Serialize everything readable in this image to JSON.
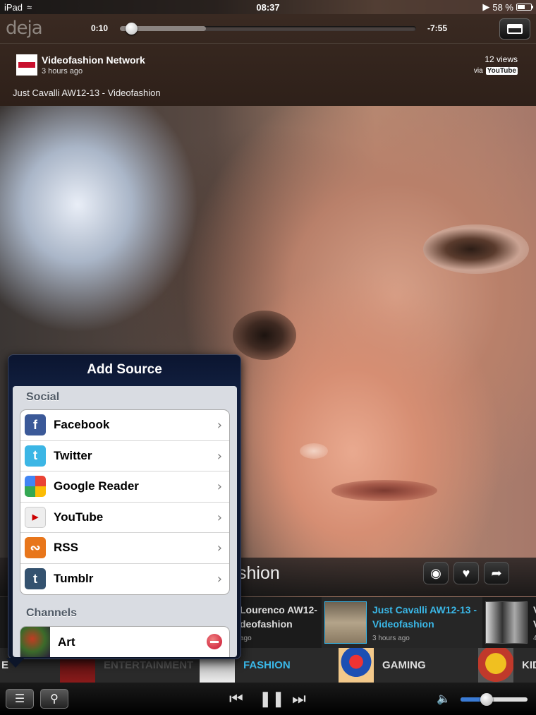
{
  "status": {
    "device": "iPad",
    "time": "08:37",
    "battery": "58 %",
    "battery_level": 0.58
  },
  "player": {
    "logo": "deja",
    "elapsed": "0:10",
    "remaining": "-7:55",
    "progress": 0.02,
    "buffered": 0.29
  },
  "info": {
    "channel_name": "Videofashion Network",
    "posted": "3 hours ago",
    "views": "12 views",
    "via": "via",
    "via_source": "YouTube",
    "title": "Just Cavalli AW12-13 - Videofashion"
  },
  "category_title": "shion",
  "strip": [
    {
      "title_line1": "Lourenco AW12-",
      "title_line2": "deofashion",
      "time": "ago",
      "active": false
    },
    {
      "title_line1": "Just Cavalli AW12-13 -",
      "title_line2": "Videofashion",
      "time": "3 hours ago",
      "active": true
    },
    {
      "title_line1": "V",
      "title_line2": "V",
      "time": "4",
      "active": false
    }
  ],
  "channels": [
    {
      "label": "E"
    },
    {
      "label": "ENTERTAINMENT"
    },
    {
      "label": "FASHION",
      "active": true
    },
    {
      "label": "GAMING"
    },
    {
      "label": "KID"
    }
  ],
  "controls": {
    "volume": 0.37
  },
  "popover": {
    "title": "Add Source",
    "sections": {
      "social": {
        "header": "Social",
        "items": [
          {
            "label": "Facebook",
            "icon": "facebook-icon"
          },
          {
            "label": "Twitter",
            "icon": "twitter-icon"
          },
          {
            "label": "Google Reader",
            "icon": "google-reader-icon"
          },
          {
            "label": "YouTube",
            "icon": "youtube-icon"
          },
          {
            "label": "RSS",
            "icon": "rss-icon"
          },
          {
            "label": "Tumblr",
            "icon": "tumblr-icon"
          }
        ]
      },
      "channels": {
        "header": "Channels",
        "items": [
          {
            "label": "Art"
          }
        ]
      }
    }
  },
  "colors": {
    "accent": "#3ab8e8",
    "delete": "#c8102e"
  }
}
